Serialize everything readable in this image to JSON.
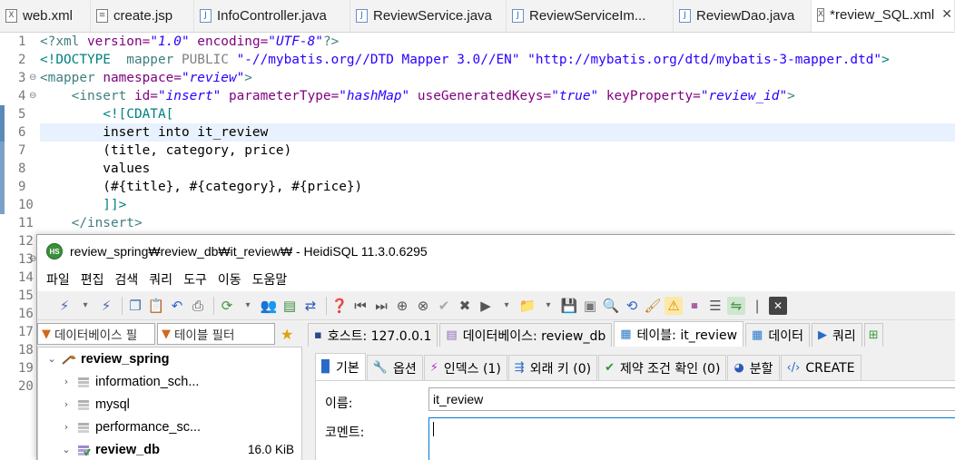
{
  "editor": {
    "tabs": [
      {
        "label": "web.xml",
        "type": "xml",
        "active": false
      },
      {
        "label": "create.jsp",
        "type": "jsp",
        "active": false
      },
      {
        "label": "InfoController.java",
        "type": "java",
        "active": false
      },
      {
        "label": "ReviewService.java",
        "type": "java",
        "active": false
      },
      {
        "label": "ReviewServiceIm...",
        "type": "java",
        "active": false
      },
      {
        "label": "ReviewDao.java",
        "type": "java",
        "active": false
      },
      {
        "label": "*review_SQL.xml",
        "type": "xml",
        "active": true
      }
    ],
    "tab_close_glyph": "✕",
    "line_numbers": [
      "1",
      "2",
      "3",
      "4",
      "5",
      "6",
      "7",
      "8",
      "9",
      "10",
      "11",
      "12",
      "13",
      "14",
      "15",
      "16",
      "17",
      "18",
      "19",
      "20"
    ],
    "current_line": 6,
    "code": {
      "xml_decl_open": "<?xml",
      "version_attr": " version=",
      "version_val": "\"1.0\"",
      "encoding_attr": " encoding=",
      "encoding_val": "\"UTF-8\"",
      "xml_decl_close": "?>",
      "doctype_open": "<!DOCTYPE",
      "doctype_name": "  mapper",
      "doctype_public": " PUBLIC ",
      "doctype_pubid": "\"-//mybatis.org//DTD Mapper 3.0//EN\"",
      "doctype_sysid": " \"http://mybatis.org/dtd/mybatis-3-mapper.dtd\"",
      "doctype_close": ">",
      "mapper_open": "<mapper",
      "namespace_attr": " namespace=",
      "namespace_val": "\"review\"",
      "tag_close": ">",
      "insert_indent": "    ",
      "insert_open": "<insert",
      "id_attr": " id=",
      "id_val": "\"insert\"",
      "ptype_attr": " parameterType=",
      "ptype_val": "\"hashMap\"",
      "ugk_attr": " useGeneratedKeys=",
      "ugk_val": "\"true\"",
      "kp_attr": " keyProperty=",
      "kp_val": "\"review_id\"",
      "line5": "        <![CDATA[",
      "line6": "        insert into it_review",
      "line7": "        (title, category, price)",
      "line8": "        values",
      "line9": "        (#{title}, #{category}, #{price})",
      "line10": "        ]]>",
      "line11": "    </insert>"
    }
  },
  "heidi": {
    "title": "review_spring₩review_db₩it_review₩ - HeidiSQL 11.3.0.6295",
    "app_icon": "HS",
    "menu": [
      "파일",
      "편집",
      "검색",
      "쿼리",
      "도구",
      "이동",
      "도움말"
    ],
    "filters": {
      "db_filter": "데이터베이스 필",
      "table_filter": "테이블 필터"
    },
    "main_tabs": [
      {
        "label": "호스트: 127.0.0.1",
        "icon": "host-icon",
        "active": false
      },
      {
        "label": "데이터베이스: review_db",
        "icon": "database-icon",
        "active": false
      },
      {
        "label": "테이블: it_review",
        "icon": "table-icon",
        "active": true
      },
      {
        "label": "데이터",
        "icon": "grid-icon",
        "active": false
      },
      {
        "label": "쿼리",
        "icon": "play-icon",
        "active": false
      }
    ],
    "tree": [
      {
        "label": "review_spring",
        "expanded": true,
        "level": 0,
        "bold": true,
        "size": ""
      },
      {
        "label": "information_sch...",
        "expanded": false,
        "level": 1,
        "bold": false,
        "size": ""
      },
      {
        "label": "mysql",
        "expanded": false,
        "level": 1,
        "bold": false,
        "size": ""
      },
      {
        "label": "performance_sc...",
        "expanded": false,
        "level": 1,
        "bold": false,
        "size": ""
      },
      {
        "label": "review_db",
        "expanded": true,
        "level": 1,
        "bold": true,
        "size": "16.0 KiB"
      }
    ],
    "sub_tabs": [
      {
        "label": "기본",
        "icon": "info-icon",
        "active": true
      },
      {
        "label": "옵션",
        "icon": "wrench-icon",
        "active": false
      },
      {
        "label": "인덱스 (1)",
        "icon": "lightning-icon",
        "active": false
      },
      {
        "label": "외래 키 (0)",
        "icon": "foreign-key-icon",
        "active": false
      },
      {
        "label": "제약 조건 확인 (0)",
        "icon": "check-icon",
        "active": false
      },
      {
        "label": "분할",
        "icon": "partition-icon",
        "active": false
      },
      {
        "label": "CREATE",
        "icon": "code-icon",
        "active": false
      }
    ],
    "form": {
      "name_label": "이름:",
      "name_value": "it_review",
      "comment_label": "코멘트:",
      "comment_value": ""
    },
    "colors": {
      "accent": "#0078d7",
      "current_line": "#e8f2fe",
      "tag": "#3f7f7f",
      "attr": "#7f007f",
      "value": "#2a00ff"
    }
  }
}
